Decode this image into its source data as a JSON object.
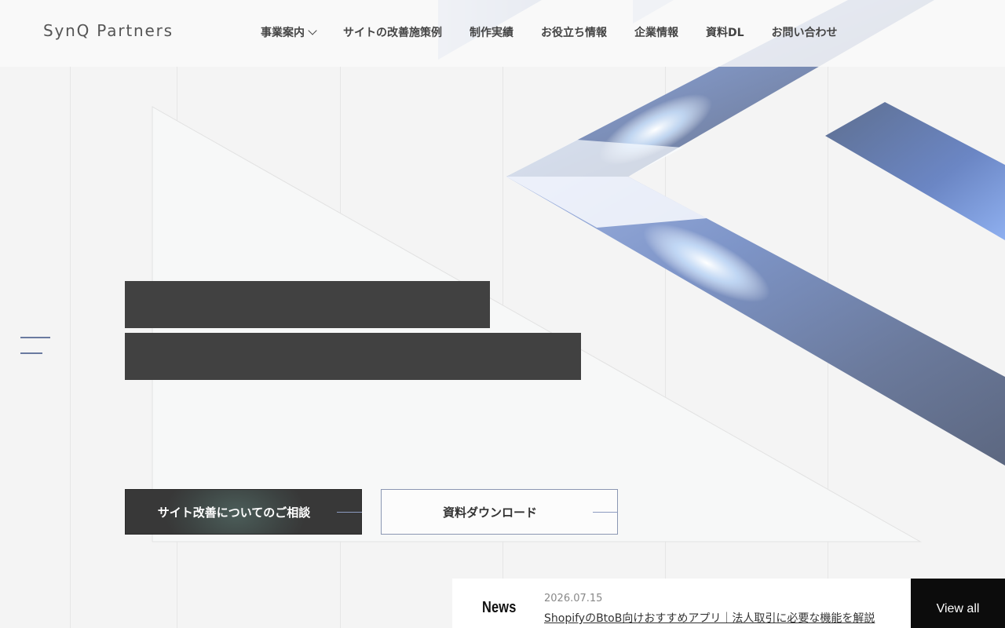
{
  "header": {
    "logo": "SynQ Partners",
    "nav": [
      {
        "label": "事業案内",
        "has_dropdown": true
      },
      {
        "label": "サイトの改善施策例"
      },
      {
        "label": "制作実績"
      },
      {
        "label": "お役立ち情報"
      },
      {
        "label": "企業情報"
      },
      {
        "label": "資料DL"
      },
      {
        "label": "お問い合わせ"
      }
    ]
  },
  "menu": {
    "icon": "hamburger-icon"
  },
  "hero": {
    "line1": "",
    "line2": ""
  },
  "cta": {
    "primary": "サイト改善についてのご相談",
    "secondary": "資料ダウンロード"
  },
  "news": {
    "label": "News",
    "date": "2026.07.15",
    "title": "ShopifyのBtoB向けおすすめアプリ｜法人取引に必要な機能を解説",
    "view_all": "View all"
  },
  "colors": {
    "accent": "#6a7aa0",
    "dark": "#414141",
    "news_button": "#0c0c0c",
    "background": "#f4f4f4"
  }
}
